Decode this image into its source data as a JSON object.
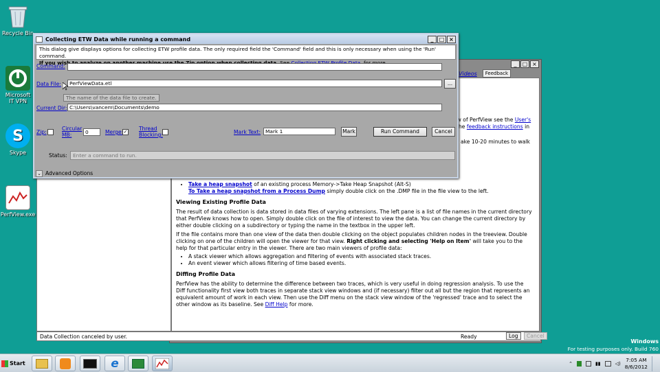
{
  "desktop": {
    "icons": [
      {
        "label": "Recycle Bin",
        "icon": "recycle-bin-icon"
      },
      {
        "label": "Microsoft IT VPN",
        "icon": "vpn-icon"
      },
      {
        "label": "Skype",
        "icon": "skype-icon"
      },
      {
        "label": "PerfView.exe",
        "icon": "perfview-icon"
      }
    ]
  },
  "bg_window": {
    "videos_link": "Videos",
    "feedback_button": "Feedback",
    "help": {
      "frag1": "ew of PerfView see the ",
      "frag1_link": "User's",
      "frag2_prefix": "the ",
      "frag2_link": "feedback instructions",
      "frag2_suffix": " in",
      "frag3": "ake 10-20 minutes to walk",
      "heap_link1": "Take a heap snapshot",
      "heap_text1": " of an existing process Memory->Take Heap Snapshot (Alt-S)",
      "heap_link2": "To Take a heap snapshot from a Process Dump",
      "heap_text2": " simply double click on the .DMP file in the file view to the left.",
      "viewing_heading": "Viewing Existing Profile Data",
      "viewing_p1": "The result of data collection is data stored in data files of varying extensions. The left pane is a list of file names in the current directory that PerfView knows how to open. Simply double click on the file of interest to view the data. You can change the current directory by either double clicking on a subdirectory or typing the name in the textbox in the upper left.",
      "viewing_p2a": "If the file contains more than one view of the data then double clicking on the object populates children nodes in the treeview. Double clicking on one of the children will open the viewer for that view. ",
      "viewing_p2b": "Right clicking and selecting 'Help on Item'",
      "viewing_p2c": " will take you to the help for that particular entry in the viewer. There are two main viewers of profile data:",
      "viewers": [
        "A stack viewer which allows aggregation and filtering of events with associated stack traces.",
        "An event viewer which allows filtering of time based events."
      ],
      "diffing_heading": "Diffing Profile Data",
      "diffing_p": "PerfView has the ability to determine the difference between two traces, which is very useful in doing regression analysis. To use the Diff functionality first view both traces in separate stack view windows and (if necessary) filter out all but the region that represents an equivalent amount of work in each view. Then use the Diff menu on the stack view window of the 'regressed' trace and to select the other window as its baseline. See ",
      "diffing_link": "Diff Help",
      "diffing_suffix": " for more."
    },
    "status": {
      "message": "Data Collection canceled by user.",
      "ready": "Ready",
      "log_button": "Log",
      "cancel_button": "Cancel"
    }
  },
  "dialog": {
    "title": "Collecting ETW Data while running a command",
    "desc_line1": "This dialog give displays options for collecting ETW profile data. The only required field the 'Command' field and this is only necessary when using the 'Run' command.",
    "desc_line2_bold": "If you wish to analyze on another machine use the Zip option when collecting data.",
    "desc_line2_see": " See ",
    "desc_link": "Collecting ETW Profile Data.",
    "desc_suffix": " for more.",
    "command_label": "Command:",
    "command_value": "",
    "datafile_label": "Data File:",
    "datafile_value": "PerfViewData.etl",
    "browse_button": "...",
    "tooltip": "The name of the data file to create.",
    "currentdir_label": "Current Dir:",
    "currentdir_value": "C:\\Users\\vancem\\Documents\\demo",
    "zip_label": "Zip:",
    "circular_label_1": "Circular",
    "circular_label_2": "MB:",
    "circular_value": "0",
    "merge_label": "Merge:",
    "merge_checked": "✓",
    "thread_label_1": "Thread",
    "thread_label_2": "Blocking:",
    "marktext_label": "Mark Text:",
    "marktext_value": "Mark 1",
    "mark_button": "Mark",
    "run_button": "Run Command",
    "cancel_button": "Cancel",
    "status_label": "Status:",
    "status_placeholder": "Enter a command to run.",
    "advanced_label": "Advanced Options"
  },
  "taskbar": {
    "start_label": "Start",
    "clock_time": "7:05 AM",
    "clock_date": "8/6/2012",
    "watermark_line1": "Windows",
    "watermark_line2": "For testing purposes only. Build 760"
  }
}
